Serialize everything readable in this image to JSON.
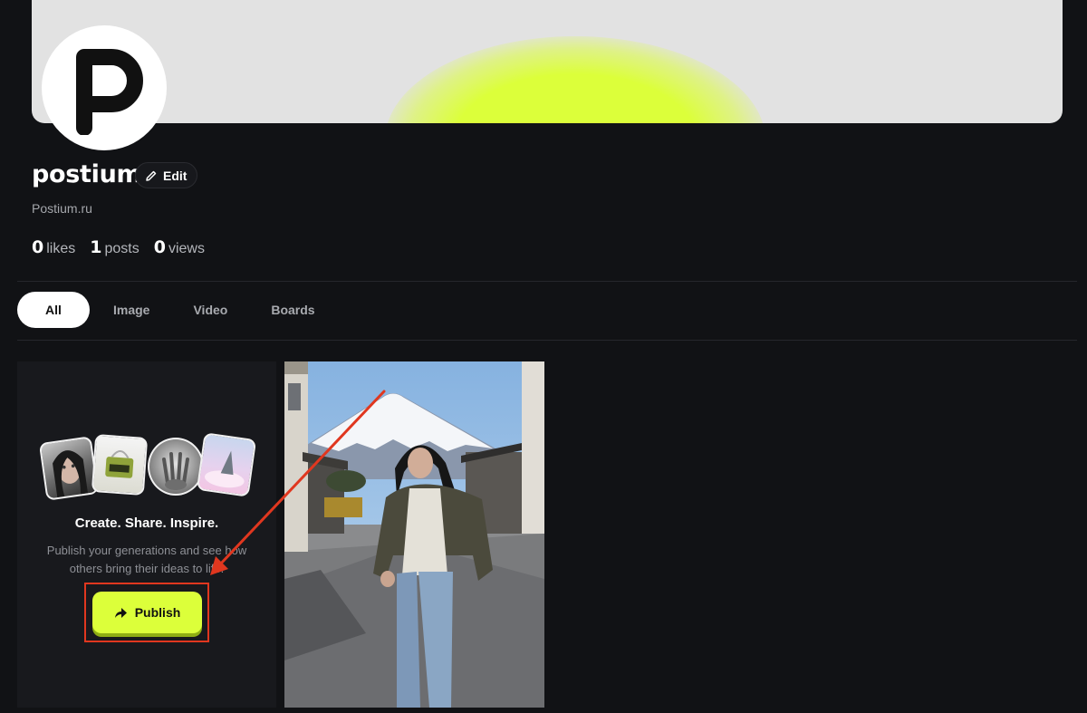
{
  "profile": {
    "name": "postium",
    "edit_label": "Edit",
    "website": "Postium.ru"
  },
  "stats": [
    {
      "value": "0",
      "label": "likes"
    },
    {
      "value": "1",
      "label": "posts"
    },
    {
      "value": "0",
      "label": "views"
    }
  ],
  "tabs": [
    {
      "label": "All",
      "active": true
    },
    {
      "label": "Image",
      "active": false
    },
    {
      "label": "Video",
      "active": false
    },
    {
      "label": "Boards",
      "active": false
    }
  ],
  "publish_card": {
    "title": "Create. Share. Inspire.",
    "description": "Publish your generations and see how others bring their ideas to life.",
    "button_label": "Publish"
  },
  "colors": {
    "accent": "#dcff3a",
    "background": "#111215",
    "annotation": "#e0371f"
  }
}
